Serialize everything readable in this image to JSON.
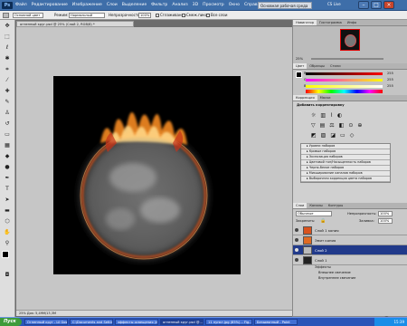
{
  "app": {
    "logo": "Ps",
    "workspace": "Основная рабочая среда",
    "cs_live": "CS Live",
    "menu": [
      "Файл",
      "Редактирование",
      "Изображение",
      "Слои",
      "Выделение",
      "Фильтр",
      "Анализ",
      "3D",
      "Просмотр",
      "Окно",
      "Справка"
    ]
  },
  "options": {
    "preset": "Основной цвет",
    "mode_label": "Режим:",
    "mode_value": "Нормальный",
    "opacity_label": "Непрозрачность:",
    "opacity_value": "100%",
    "smooth_label": "Сглаживание",
    "adjacent_label": "Смеж.пикс.",
    "all_layers_label": "Все слои"
  },
  "document": {
    "tab_title": "огненный круг.psd @ 25% (Слой 2, RGB/8) *",
    "status": "25%   Док: 5,49M/13,3M"
  },
  "navigator": {
    "tabs": [
      "Навигатор",
      "Гистограмма",
      "Инфо"
    ],
    "zoom": "25%"
  },
  "color": {
    "tabs": [
      "Цвет",
      "Образцы",
      "Стили"
    ],
    "channels": [
      {
        "label": "R",
        "value": "255",
        "color": "#e03030"
      },
      {
        "label": "G",
        "value": "255",
        "color": "#30c030"
      },
      {
        "label": "B",
        "value": "255",
        "color": "#3050e0"
      }
    ]
  },
  "adjustments": {
    "tabs": [
      "Коррекция",
      "Маски"
    ],
    "title": "Добавить корректировку",
    "presets": [
      "Уровни наборов",
      "Кривые наборов",
      "Экспозиция наборов",
      "Цветовой тон/Насыщенность наборов",
      "Черно-белое наборов",
      "Микширование каналов наборов",
      "Выборочная коррекция цвета наборов"
    ]
  },
  "layers": {
    "tabs": [
      "Слои",
      "Каналы",
      "Контуры"
    ],
    "blend": "Обычные",
    "opacity_label": "Непрозрачность:",
    "opacity_value": "100%",
    "lock_label": "Закрепить:",
    "fill_label": "Заливка:",
    "fill_value": "100%",
    "items": [
      {
        "name": "Слой 1 копия",
        "selected": false
      },
      {
        "name": "Эмит копия",
        "selected": false
      },
      {
        "name": "Слой 2",
        "selected": true
      },
      {
        "name": "Слой 1",
        "selected": false
      }
    ],
    "effects_label": "Эффекты",
    "effects": [
      "Внешнее свечение",
      "Внутреннее свечение"
    ]
  },
  "taskbar": {
    "start": "Пуск",
    "tasks": [
      "Огненный круг - Lil Gos...",
      "C:\\Documents and Settin...",
      "эффекты освещения (н...",
      "огненный круг.psd @...",
      "11 пункт.jpg (85%)... Fig...",
      "Безымянный - Paint"
    ],
    "active_task": 3,
    "clock": "15:39"
  }
}
